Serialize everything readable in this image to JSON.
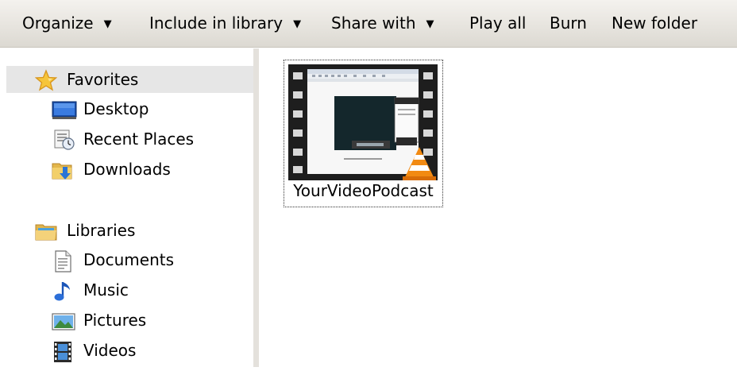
{
  "toolbar": {
    "organize": "Organize",
    "include_in_library": "Include in library",
    "share_with": "Share with",
    "play_all": "Play all",
    "burn": "Burn",
    "new_folder": "New folder"
  },
  "nav": {
    "favorites": {
      "label": "Favorites",
      "icon": "star-icon",
      "items": [
        {
          "label": "Desktop",
          "icon": "desktop-icon"
        },
        {
          "label": "Recent Places",
          "icon": "recent-places-icon"
        },
        {
          "label": "Downloads",
          "icon": "downloads-icon"
        }
      ]
    },
    "libraries": {
      "label": "Libraries",
      "icon": "libraries-folder-icon",
      "items": [
        {
          "label": "Documents",
          "icon": "document-icon"
        },
        {
          "label": "Music",
          "icon": "music-note-icon"
        },
        {
          "label": "Pictures",
          "icon": "pictures-icon"
        },
        {
          "label": "Videos",
          "icon": "film-strip-icon"
        }
      ]
    }
  },
  "content": {
    "files": [
      {
        "name": "YourVideoPodcast",
        "type": "video",
        "overlay_icon": "vlc-cone-icon"
      }
    ]
  },
  "colors": {
    "toolbar_top": "#f4f2ee",
    "toolbar_bottom": "#dcd9d2",
    "selected_row": "#e6e6e6",
    "splitter": "#e4e1dc"
  }
}
